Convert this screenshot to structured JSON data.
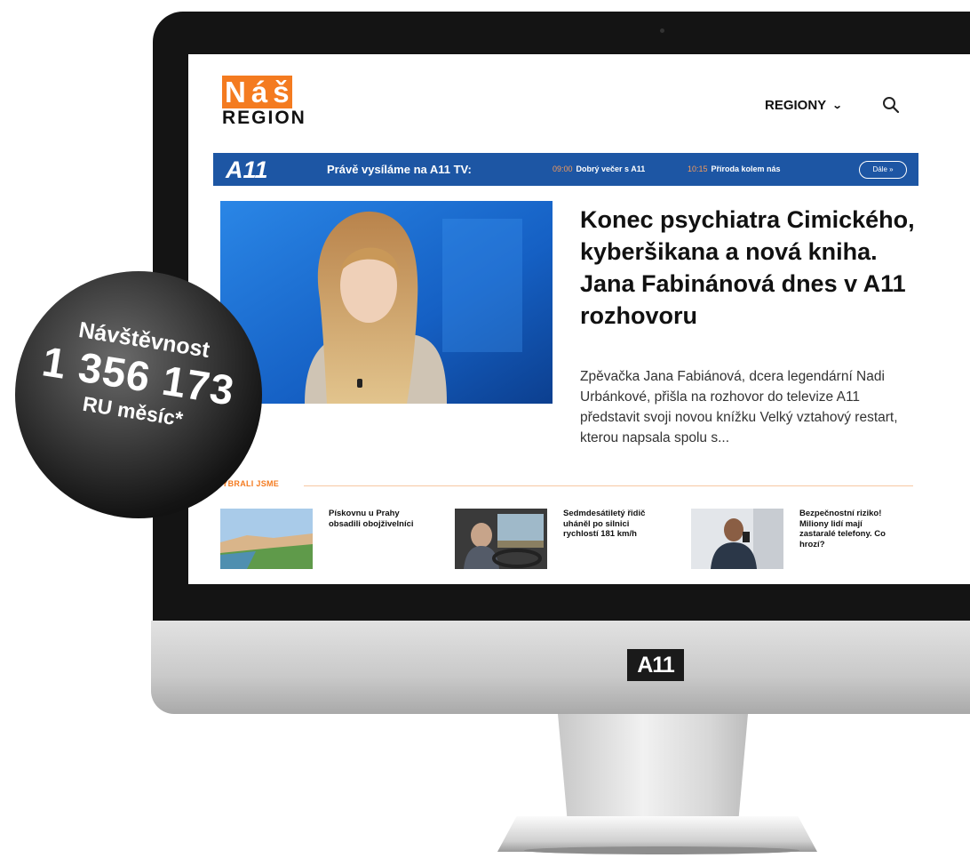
{
  "site": {
    "logo_top": [
      "N",
      "á",
      "š"
    ],
    "logo_bottom": "REGION",
    "nav_regions": "REGIONY"
  },
  "tv_bar": {
    "brand": "A11",
    "now_label": "Právě vysíláme na A11 TV:",
    "slots": [
      {
        "time": "09:00",
        "title": "Dobrý večer s A11"
      },
      {
        "time": "10:15",
        "title": "Příroda kolem nás"
      }
    ],
    "more_label": "Dále »"
  },
  "hero": {
    "headline": "Konec psychiatra Cimického, kyberšikana a nová kniha. Jana Fabinánová dnes v A11 rozhovoru",
    "lede": "Zpěvačka Jana Fabiánová, dcera legendární Nadi Urbánkové, přišla na rozhovor do televize A11 představit svoji novou knížku Velký vztahový restart, kterou napsala spolu s..."
  },
  "section_label": "VYBRALI JSME",
  "cards": [
    {
      "title": "Pískovnu u Prahy obsadili obojživelníci"
    },
    {
      "title": "Sedmdesátiletý řidič uháněl po silnici rychlostí 181 km/h"
    },
    {
      "title": "Bezpečnostní riziko! Miliony lidí mají zastaralé telefony. Co hrozí?"
    }
  ],
  "monitor_brand": "A11",
  "badge": {
    "line1": "Návštěvnost",
    "line2": "1 356 173",
    "line3": "RU měsíc*"
  },
  "colors": {
    "accent": "#f47b20",
    "tv_bar": "#1d56a4"
  }
}
